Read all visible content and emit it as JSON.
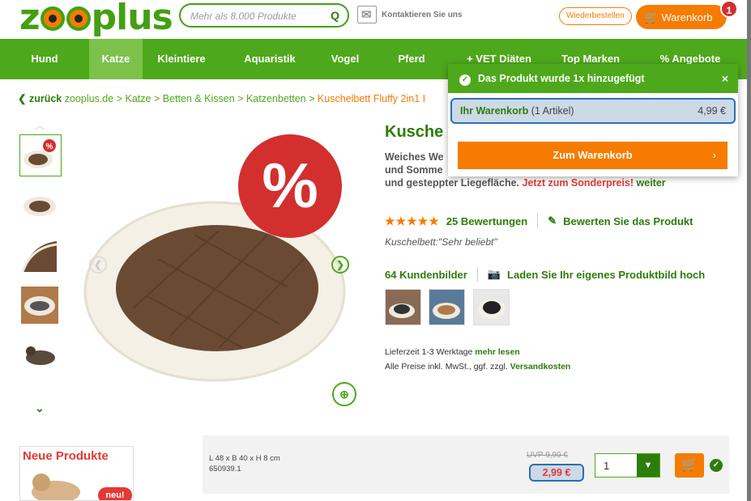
{
  "header": {
    "logo": "zooplus",
    "search_placeholder": "Mehr als 8.000 Produkte",
    "contact_label": "Kontaktieren Sie uns",
    "reorder_label": "Wiederbestellen",
    "cart_label": "Warenkorb",
    "cart_count": "1"
  },
  "nav": {
    "items": [
      {
        "label": "Hund",
        "active": false
      },
      {
        "label": "Katze",
        "active": true
      },
      {
        "label": "Kleintiere",
        "active": false
      },
      {
        "label": "Aquaristik",
        "active": false
      },
      {
        "label": "Vogel",
        "active": false
      },
      {
        "label": "Pferd",
        "active": false
      },
      {
        "label": "+ VET Diäten",
        "active": false
      },
      {
        "label": "Top Marken",
        "active": false
      },
      {
        "label": "% Angebote",
        "active": false
      }
    ]
  },
  "breadcrumb": {
    "back": "zurück",
    "items": [
      "zooplus.de",
      "Katze",
      "Betten & Kissen",
      "Katzenbetten"
    ],
    "current": "Kuschelbett Fluffy 2in1 I"
  },
  "product": {
    "title": "Kusche",
    "desc_line1": "Weiches We",
    "desc_line2": "und Somme",
    "desc_line3": "und gesteppter Liegefläche.",
    "desc_sale": "Jetzt zum Sonderpreis!",
    "desc_more": "weiter",
    "stars": "★★★★★",
    "reviews": "25 Bewertungen",
    "rate_link": "Bewerten Sie das Produkt",
    "popular": "Kuschelbett:\"Sehr beliebt\"",
    "customer_images": "64 Kundenbilder",
    "upload_link": "Laden Sie Ihr eigenes Produktbild hoch",
    "delivery_text": "Lieferzeit 1-3 Werktage",
    "delivery_more": "mehr lesen",
    "prices_text": "Alle Preise inkl. MwSt., ggf. zzgl.",
    "shipping_link": "Versandkosten",
    "sale_badge": "%"
  },
  "variant": {
    "size": "L 48 x B 40 x H 8 cm",
    "sku": "650939.1",
    "uvp": "UVP 9,99 €",
    "price": "2,99 €",
    "quantity": "1"
  },
  "new_products": {
    "title": "Neue Produkte",
    "badge": "neu!"
  },
  "popup": {
    "message": "Das Produkt wurde 1x hinzugefügt",
    "cart_label": "Ihr Warenkorb",
    "cart_items": "(1 Artikel)",
    "cart_sum": "4,99 €",
    "goto_cart": "Zum Warenkorb"
  },
  "colors": {
    "brand_green": "#4ea81b",
    "dark_green": "#2d7d0a",
    "orange": "#f57c00",
    "red": "#e53935",
    "highlight_blue": "#2a6fb3"
  }
}
